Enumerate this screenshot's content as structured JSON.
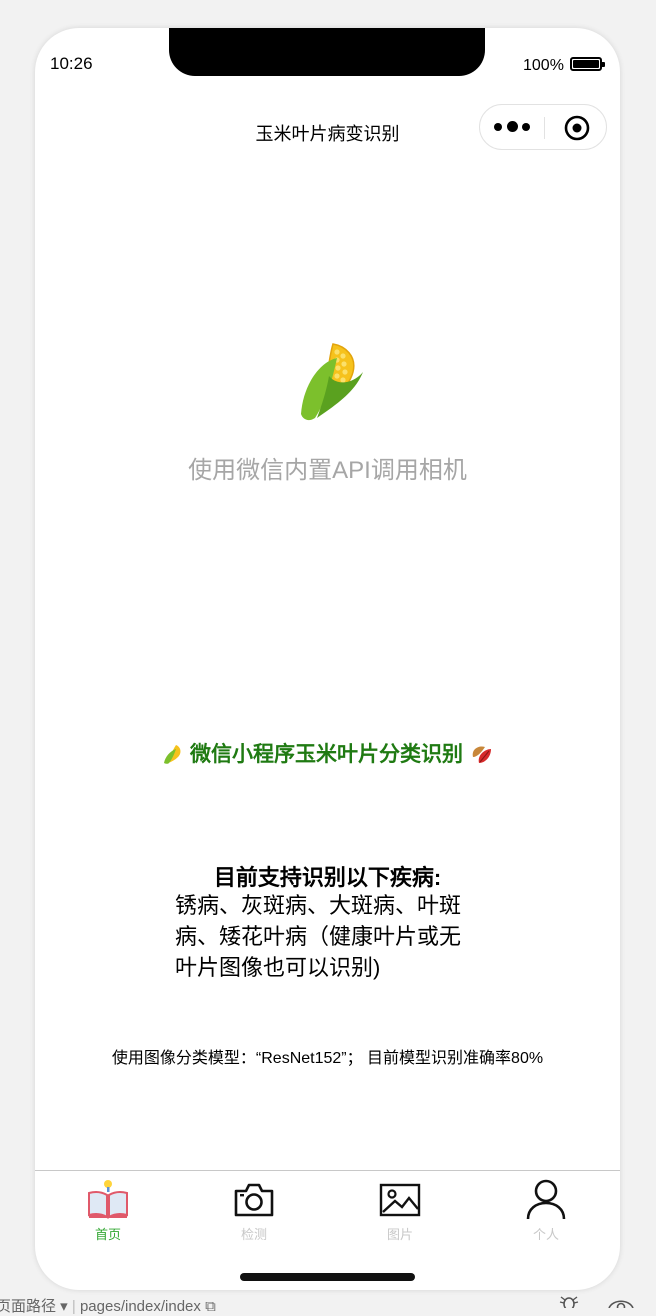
{
  "status_bar": {
    "time": "10:26",
    "battery": "100%"
  },
  "nav": {
    "title": "玉米叶片病变识别"
  },
  "hero": {
    "subtitle": "使用微信内置API调用相机"
  },
  "headline": {
    "text": "微信小程序玉米叶片分类识别"
  },
  "support": {
    "title": "目前支持识别以下疾病:",
    "body": "锈病、灰斑病、大斑病、叶斑病、矮花叶病（健康叶片或无叶片图像也可以识别)"
  },
  "model_info": "使用图像分类模型：“ResNet152”； 目前模型识别准确率80%",
  "tabbar": {
    "items": [
      {
        "label": "首页",
        "icon": "book-icon",
        "active": true
      },
      {
        "label": "检测",
        "icon": "camera-icon",
        "active": false
      },
      {
        "label": "图片",
        "icon": "image-icon",
        "active": false
      },
      {
        "label": "个人",
        "icon": "person-icon",
        "active": false
      }
    ]
  },
  "devtools_bar": {
    "path_prefix": "页面路径 ▾",
    "path": "pages/index/index"
  },
  "colors": {
    "headline": "#1f7a12",
    "tab_active": "#33a833",
    "tab_inactive": "#c8c8c8",
    "subtitle": "#a6a6a6"
  }
}
